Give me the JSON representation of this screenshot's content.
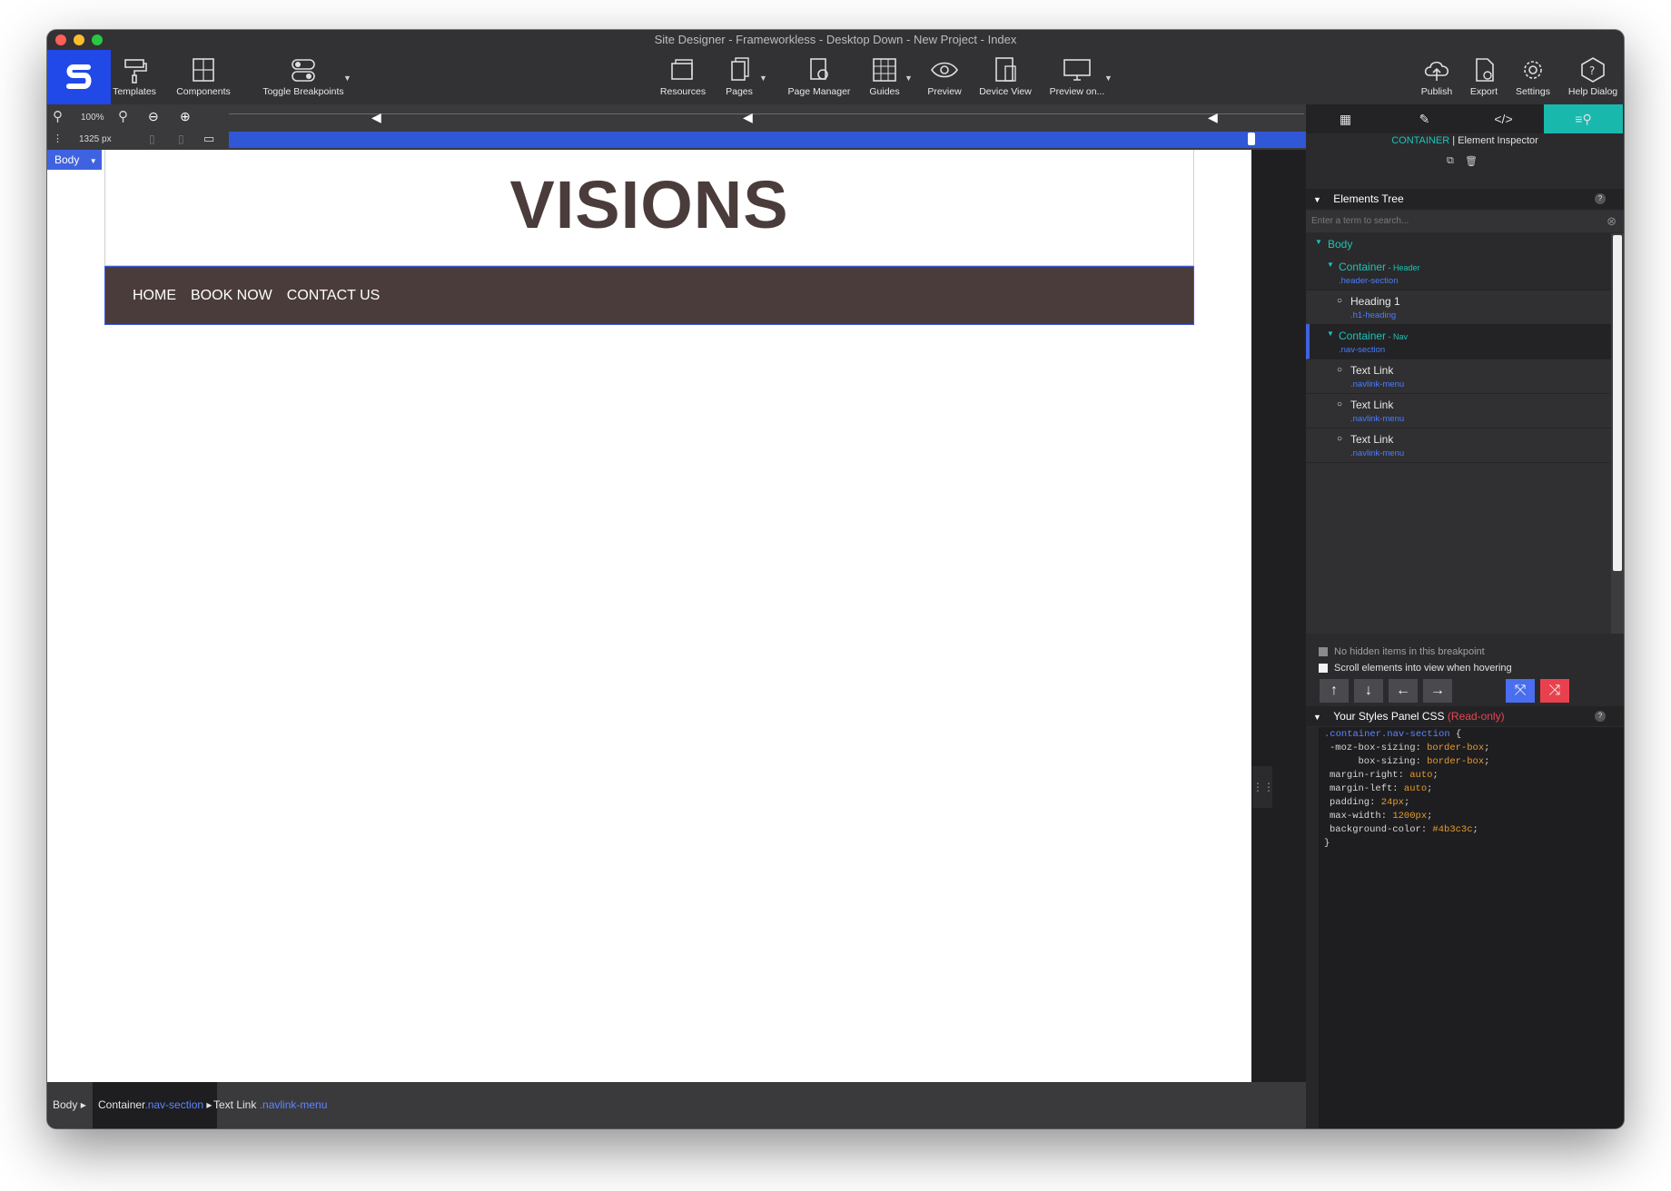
{
  "window": {
    "title": "Site Designer - Frameworkless - Desktop Down - New Project - Index"
  },
  "toolbar": {
    "templates": "Templates",
    "components": "Components",
    "toggle_breakpoints": "Toggle Breakpoints",
    "resources": "Resources",
    "pages": "Pages",
    "page_manager": "Page Manager",
    "guides": "Guides",
    "preview": "Preview",
    "device_view": "Device View",
    "preview_on": "Preview on...",
    "publish": "Publish",
    "export": "Export",
    "settings": "Settings",
    "help_dialog": "Help Dialog"
  },
  "zoom": {
    "value": "100%"
  },
  "breakpoint": {
    "width": "1325 px"
  },
  "canvas": {
    "body_tag": "Body",
    "heading": "VISIONS",
    "nav_links": [
      "HOME",
      "BOOK NOW",
      "CONTACT US"
    ],
    "nav_bg": "#4b3c3c"
  },
  "statusbar": {
    "crumb1": "Body",
    "crumb2_name": "Container",
    "crumb2_class": ".nav-section",
    "crumb3_name": "Text Link",
    "crumb3_class": ".navlink-menu"
  },
  "panel": {
    "inspector_type": "CONTAINER",
    "inspector_sep": " | ",
    "inspector_title": "Element Inspector",
    "elements_tree_title": "Elements Tree",
    "search_placeholder": "Enter a term to search...",
    "tree": [
      {
        "name": "Body"
      },
      {
        "name": "Container",
        "tag": " - Header",
        "class": ".header-section"
      },
      {
        "name": "Heading 1",
        "class": ".h1-heading"
      },
      {
        "name": "Container",
        "tag": " - Nav",
        "class": ".nav-section"
      },
      {
        "name": "Text Link",
        "class": ".navlink-menu"
      },
      {
        "name": "Text Link",
        "class": ".navlink-menu"
      },
      {
        "name": "Text Link",
        "class": ".navlink-menu"
      }
    ],
    "no_hidden": "No hidden items in this breakpoint",
    "scroll_hover": "Scroll elements into view when hovering",
    "styles_title": "Your Styles Panel CSS",
    "read_only": "(Read-only)",
    "css_lines": [
      {
        "sel": ".container.nav-section",
        "rest": " {"
      },
      {
        "prop": "-moz-box-sizing: ",
        "val": "border-box",
        "end": ";"
      },
      {
        "prop": "     box-sizing: ",
        "val": "border-box",
        "end": ";"
      },
      {
        "prop": "margin-right: ",
        "val": "auto",
        "end": ";"
      },
      {
        "prop": "margin-left: ",
        "val": "auto",
        "end": ";"
      },
      {
        "prop": "padding: ",
        "val": "24px",
        "end": ";"
      },
      {
        "prop": "max-width: ",
        "val": "1200px",
        "end": ";"
      },
      {
        "prop": "background-color: ",
        "val": "#4b3c3c",
        "end": ";"
      },
      {
        "close": "}"
      }
    ]
  },
  "colors": {
    "accent_blue": "#2149e8",
    "teal": "#19b8ad",
    "class_blue": "#4a7cff"
  }
}
